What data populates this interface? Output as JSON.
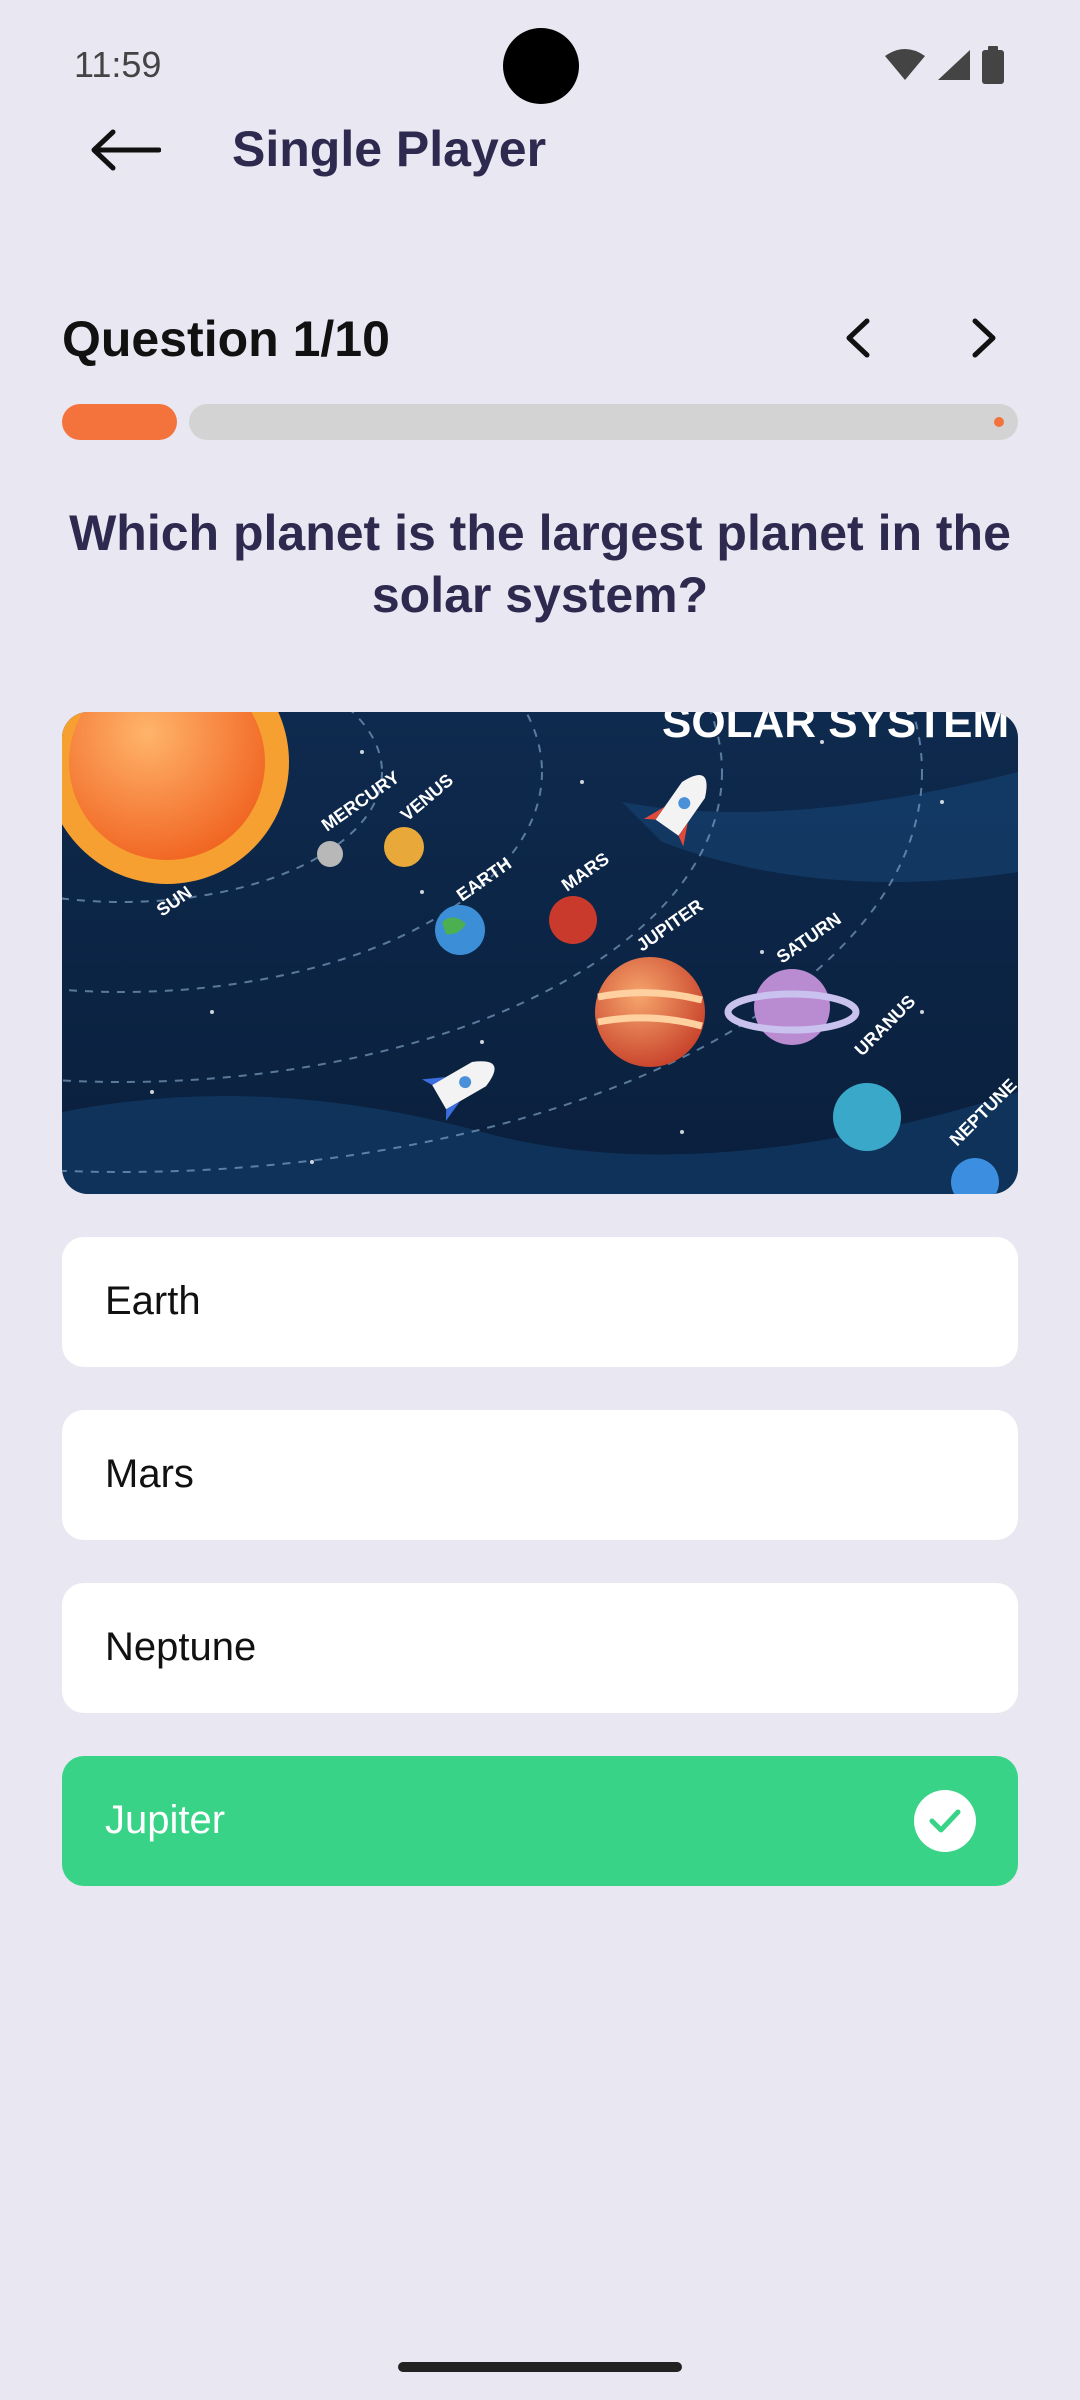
{
  "status_bar": {
    "time": "11:59",
    "icons": [
      "wifi-icon",
      "signal-icon",
      "battery-icon"
    ]
  },
  "appbar": {
    "title": "Single Player",
    "back_icon": "arrow-left-icon"
  },
  "quiz": {
    "question_count": "Question 1/10",
    "progress": 0.12,
    "question": "Which planet is the largest planet in the solar system?"
  },
  "image": {
    "heading": "SOLAR SYSTEM",
    "labels": {
      "sun": "SUN",
      "mercury": "MERCURY",
      "venus": "VENUS",
      "earth": "EARTH",
      "mars": "MARS",
      "jupiter": "JUPITER",
      "saturn": "SATURN",
      "uranus": "URANUS",
      "neptune": "NEPTUNE"
    }
  },
  "options": [
    {
      "label": "Earth",
      "state": "default"
    },
    {
      "label": "Mars",
      "state": "default"
    },
    {
      "label": "Neptune",
      "state": "default"
    },
    {
      "label": "Jupiter",
      "state": "correct"
    }
  ],
  "colors": {
    "accent": "#f4733d",
    "correct": "#38d386",
    "title": "#2e2a4f",
    "background": "#e9e7f1"
  }
}
